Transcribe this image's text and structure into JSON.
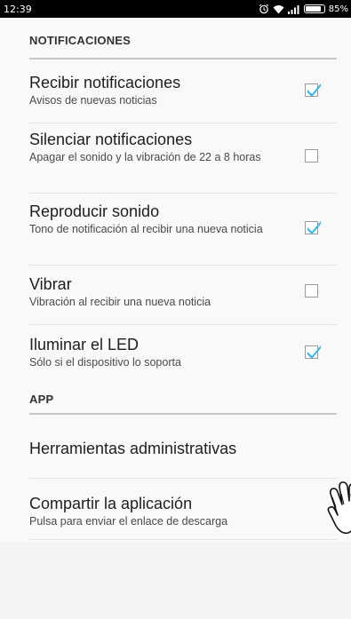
{
  "status_bar": {
    "time": "12:39",
    "battery_percent": "85%",
    "battery_level": 0.85,
    "icons": [
      "alarm-clock-icon",
      "wifi-icon",
      "signal-icon",
      "battery-icon"
    ]
  },
  "sections": {
    "notifications": {
      "header": "NOTIFICACIONES",
      "items": [
        {
          "title": "Recibir notificaciones",
          "summary": "Avisos de nuevas noticias",
          "checked": true
        },
        {
          "title": "Silenciar notificaciones",
          "summary": "Apagar el sonido y la vibración de 22 a 8 horas",
          "checked": false
        },
        {
          "title": "Reproducir sonido",
          "summary": "Tono de notificación al recibir una nueva noticia",
          "checked": true
        },
        {
          "title": "Vibrar",
          "summary": "Vibración al recibir una nueva noticia",
          "checked": false
        },
        {
          "title": "Iluminar el LED",
          "summary": "Sólo si el dispositivo lo soporta",
          "checked": true
        }
      ]
    },
    "app": {
      "header": "APP",
      "items": [
        {
          "title": "Herramientas administrativas"
        },
        {
          "title": "Compartir la aplicación",
          "summary": "Pulsa para enviar el enlace de descarga"
        }
      ]
    }
  },
  "colors": {
    "accent": "#33b5e5",
    "checkbox_border": "#9a9a9a",
    "header_underline": "#c7c7c7",
    "status_bar": "#000000"
  },
  "icons": {
    "check": "checkmark-icon",
    "cursor": "hand-pointer-icon"
  }
}
